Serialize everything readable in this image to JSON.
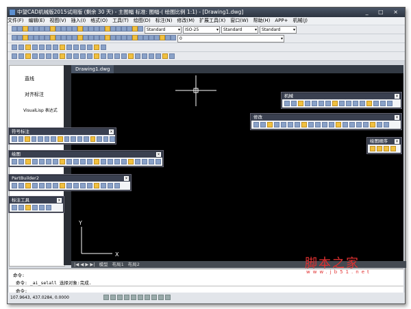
{
  "title": "中望CAD机械版2015试用版 (剩余 30 天) - 主图幅 标准: 图幅-( 绘图比例 1:1) - [Drawing1.dwg]",
  "window_controls": "_ □ ×",
  "menu": [
    "文件(F)",
    "编辑(E)",
    "视图(V)",
    "插入(I)",
    "格式(O)",
    "工具(T)",
    "绘图(D)",
    "标注(N)",
    "修改(M)",
    "扩展工具(X)",
    "窗口(W)",
    "帮助(H)",
    "APP+",
    "机械(J)"
  ],
  "selects": {
    "text_style": "Standard",
    "dim_style": "ISO-25",
    "table_style": "Standard",
    "mleader_style": "Standard",
    "layer": "0"
  },
  "left_panel": {
    "items": [
      "直线",
      "对齐标注",
      "VisualLisp 表达式"
    ]
  },
  "doc_tab": "Drawing1.dwg",
  "layout_tabs": [
    "模型",
    "布局1",
    "布局2"
  ],
  "nav": "|◀ ◀ ▶ ▶|",
  "axis": {
    "x": "X",
    "y": "Y"
  },
  "floating": [
    {
      "id": "symbol",
      "title": "符号标注"
    },
    {
      "id": "draw",
      "title": "绘图"
    },
    {
      "id": "partbuilder",
      "title": "PartBuilder2"
    },
    {
      "id": "dimtools",
      "title": "标注工具"
    },
    {
      "id": "mech",
      "title": "机械"
    },
    {
      "id": "modify",
      "title": "修改"
    },
    {
      "id": "order",
      "title": "绘图顺序"
    }
  ],
  "command": {
    "lines": [
      "命令:",
      "命令: _ai_selall 选择对象:完成."
    ],
    "prompt": "命令:"
  },
  "status": {
    "coords": "107.9643,  437.0284,  0.0000"
  },
  "watermark": {
    "text": "脚本之家",
    "url": "www.jb51.net"
  }
}
